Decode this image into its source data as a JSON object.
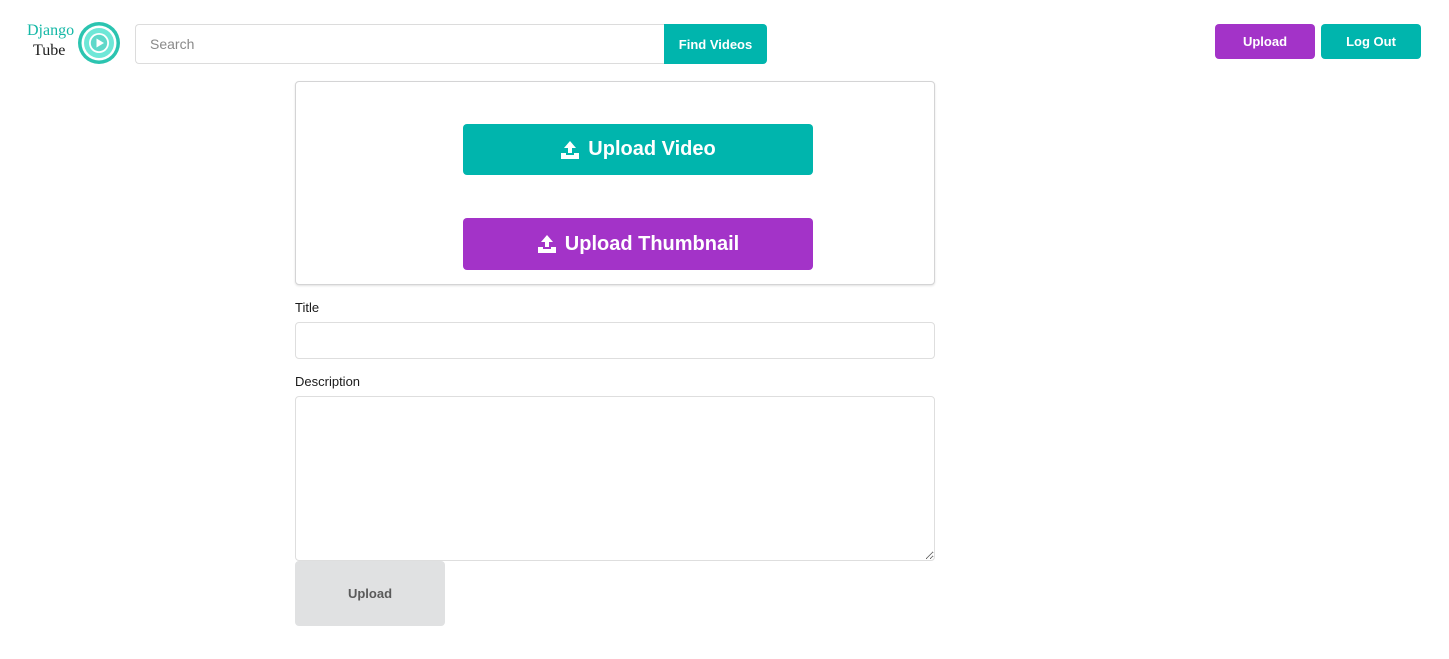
{
  "brand": {
    "line1": "Django",
    "line2": "Tube",
    "logo_icon": "play-circle-icon",
    "colors": {
      "ring": "#14b8a6",
      "inner": "#6ee7d7"
    }
  },
  "search": {
    "placeholder": "Search",
    "value": "",
    "button_label": "Find Videos"
  },
  "nav": {
    "upload_label": "Upload",
    "logout_label": "Log Out"
  },
  "upload_card": {
    "video_button_label": "Upload Video",
    "thumbnail_button_label": "Upload Thumbnail",
    "icon": "upload-icon"
  },
  "form": {
    "title_label": "Title",
    "title_value": "",
    "description_label": "Description",
    "description_value": "",
    "submit_label": "Upload"
  },
  "colors": {
    "teal": "#00b5ad",
    "purple": "#a333c8",
    "grey": "#e0e1e2"
  }
}
